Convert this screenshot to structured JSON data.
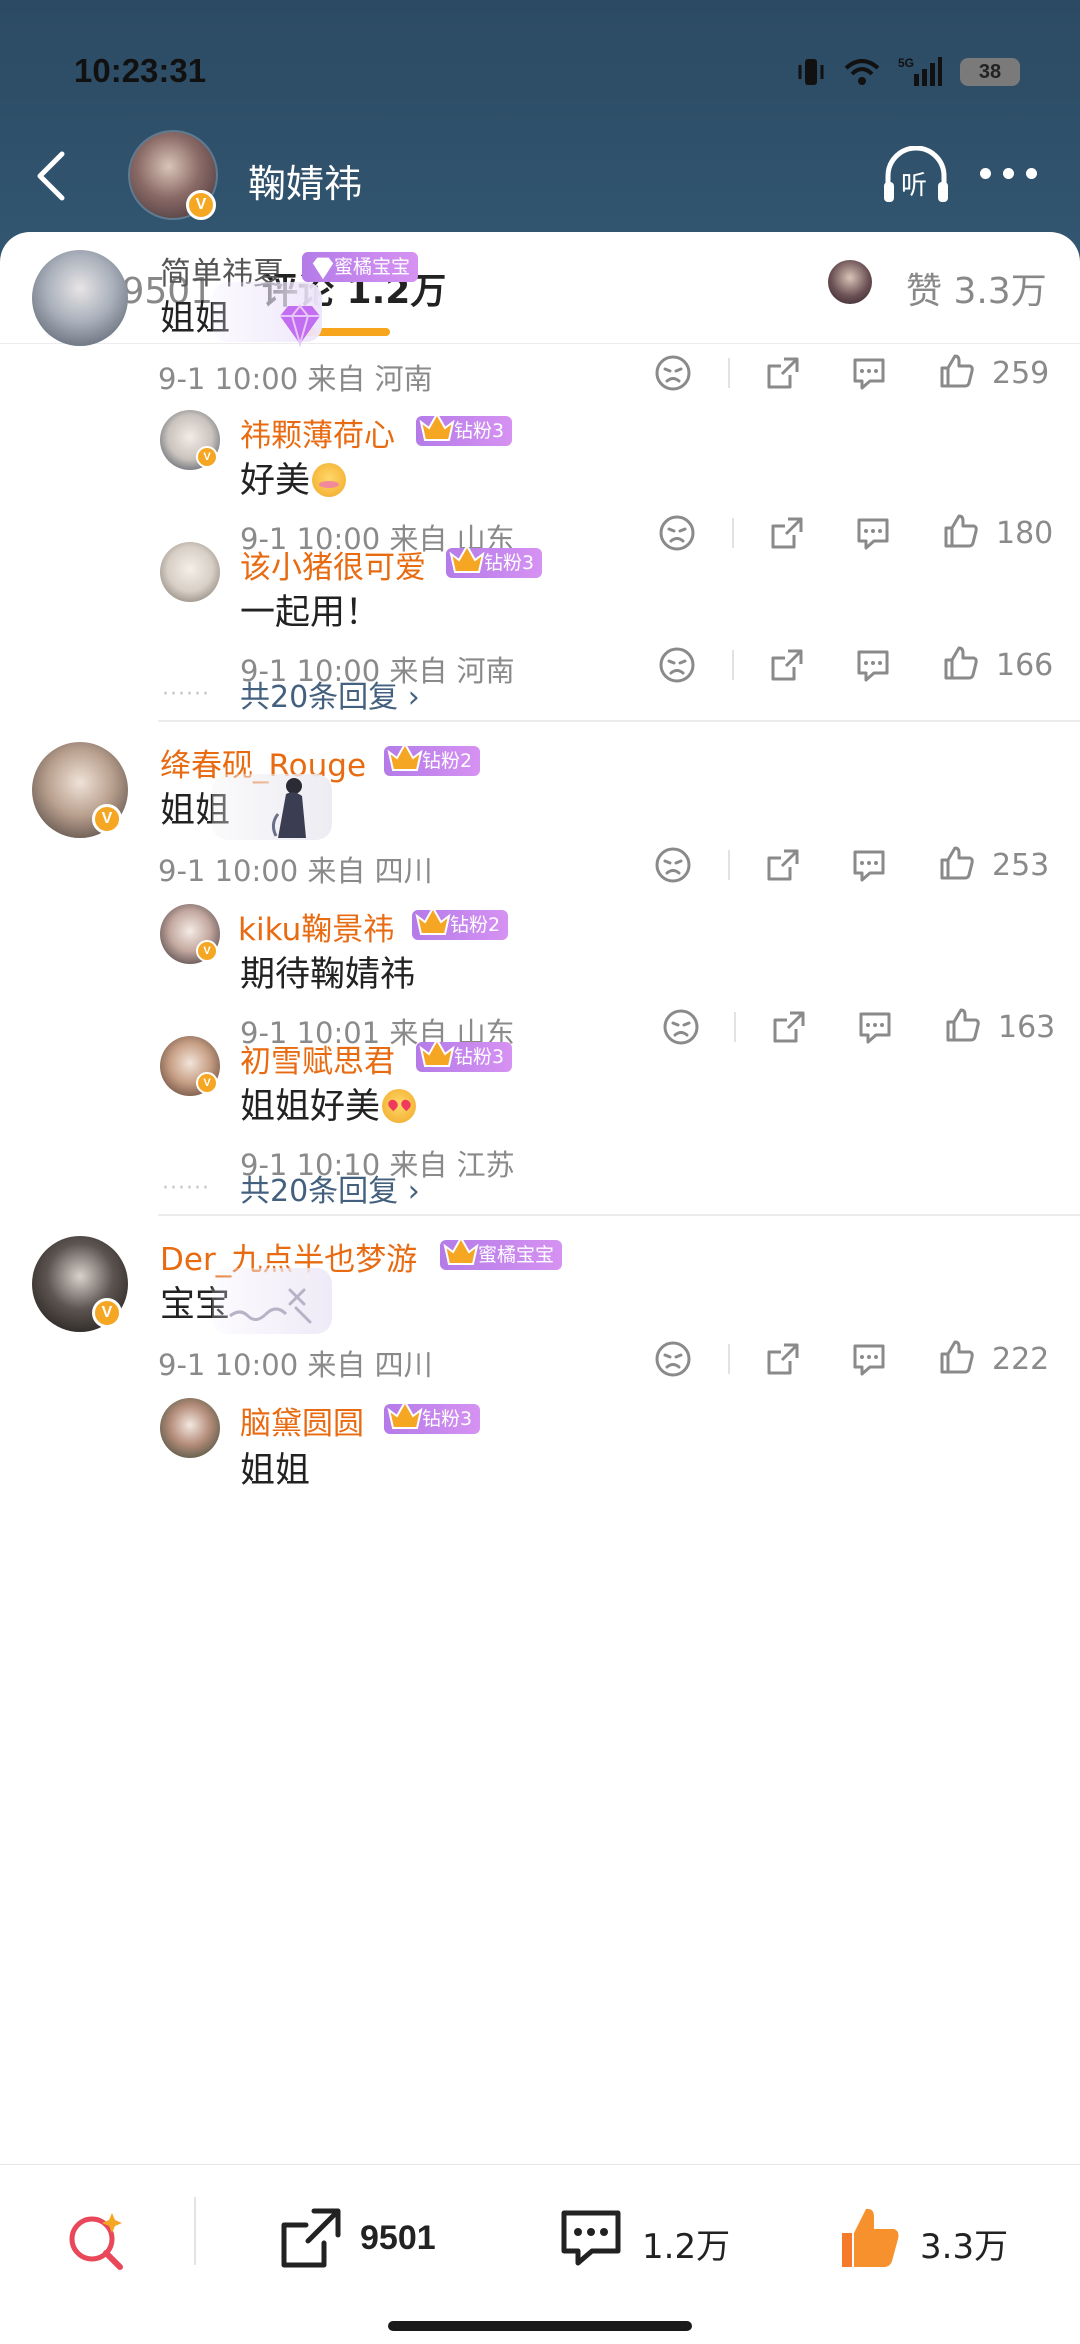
{
  "status_bar": {
    "time": "10:23:31",
    "network": "5G",
    "battery": "38"
  },
  "header": {
    "profile_name": "鞠婧祎",
    "listen_label": "听"
  },
  "tabs": {
    "repost": "转发 9501",
    "comments": "评论 1.2万",
    "likes": "赞 3.3万"
  },
  "comments": [
    {
      "username": "简单祎夏",
      "badge": "蜜橘宝宝",
      "text": "姐姐",
      "meta": "9-1 10:00 来自 河南",
      "likes": "259",
      "replies": [
        {
          "username": "祎颗薄荷心",
          "badge": "钻粉3",
          "text": "好美",
          "meta": "9-1 10:00 来自 山东",
          "likes": "180"
        },
        {
          "username": "该小猪很可爱",
          "badge": "钻粉3",
          "text": "一起用！",
          "meta": "9-1 10:00 来自 河南",
          "likes": "166"
        }
      ],
      "more_replies": "共20条回复 ›"
    },
    {
      "username": "绛春砚_Rouge",
      "badge": "钻粉2",
      "text": "姐姐",
      "meta": "9-1 10:00 来自 四川",
      "likes": "253",
      "replies": [
        {
          "username": "kiku鞠景祎",
          "badge": "钻粉2",
          "text": "期待鞠婧祎",
          "meta": "9-1 10:01 来自 山东",
          "likes": "163"
        },
        {
          "username": "初雪赋思君",
          "badge": "钻粉3",
          "text": "姐姐好美",
          "meta": "9-1 10:10 来自 江苏",
          "likes": ""
        }
      ],
      "more_replies": "共20条回复 ›"
    },
    {
      "username": "Der_九点半也梦游",
      "badge": "蜜橘宝宝",
      "text": "宝宝",
      "meta": "9-1 10:00 来自 四川",
      "likes": "222",
      "replies": [
        {
          "username": "脑黛圆圆",
          "badge": "钻粉3",
          "text": "姐姐"
        }
      ]
    }
  ],
  "bottom_bar": {
    "repost_count": "9501",
    "comment_count": "1.2万",
    "like_count": "3.3万"
  },
  "colors": {
    "accent": "#f7a51c",
    "username_orange": "#e86b12",
    "header_bg": "#2e4f69",
    "badge_purple": "#b47be8"
  }
}
